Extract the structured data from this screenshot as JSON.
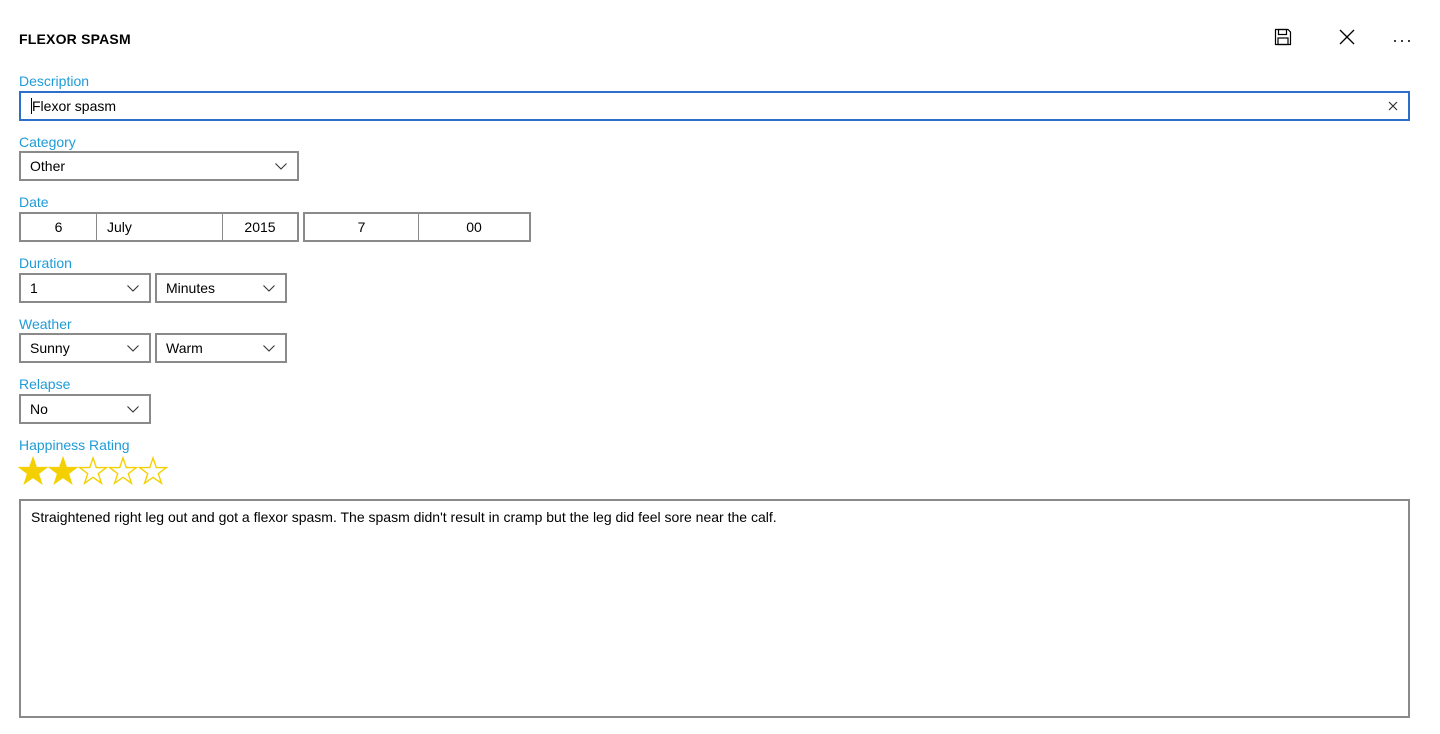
{
  "header": {
    "title": "FLEXOR SPASM",
    "save_icon": "save-icon",
    "close_icon": "close-icon",
    "more_icon": "more-icon"
  },
  "description": {
    "label": "Description",
    "value": "Flexor spasm"
  },
  "category": {
    "label": "Category",
    "value": "Other"
  },
  "date": {
    "label": "Date",
    "day": "6",
    "month": "July",
    "year": "2015",
    "hour": "7",
    "minute": "00"
  },
  "duration": {
    "label": "Duration",
    "amount": "1",
    "unit": "Minutes"
  },
  "weather": {
    "label": "Weather",
    "condition": "Sunny",
    "temperature": "Warm"
  },
  "relapse": {
    "label": "Relapse",
    "value": "No"
  },
  "happiness": {
    "label": "Happiness Rating",
    "rating": 2,
    "max": 5,
    "star_color": "#f5d000"
  },
  "notes": {
    "value": "Straightened right leg out and got a flexor spasm. The spasm didn't result in cramp but the leg did feel sore near the calf."
  },
  "colors": {
    "label": "#1e9bd7",
    "focus_border": "#2b6fcb",
    "border": "#8a8a8a"
  }
}
